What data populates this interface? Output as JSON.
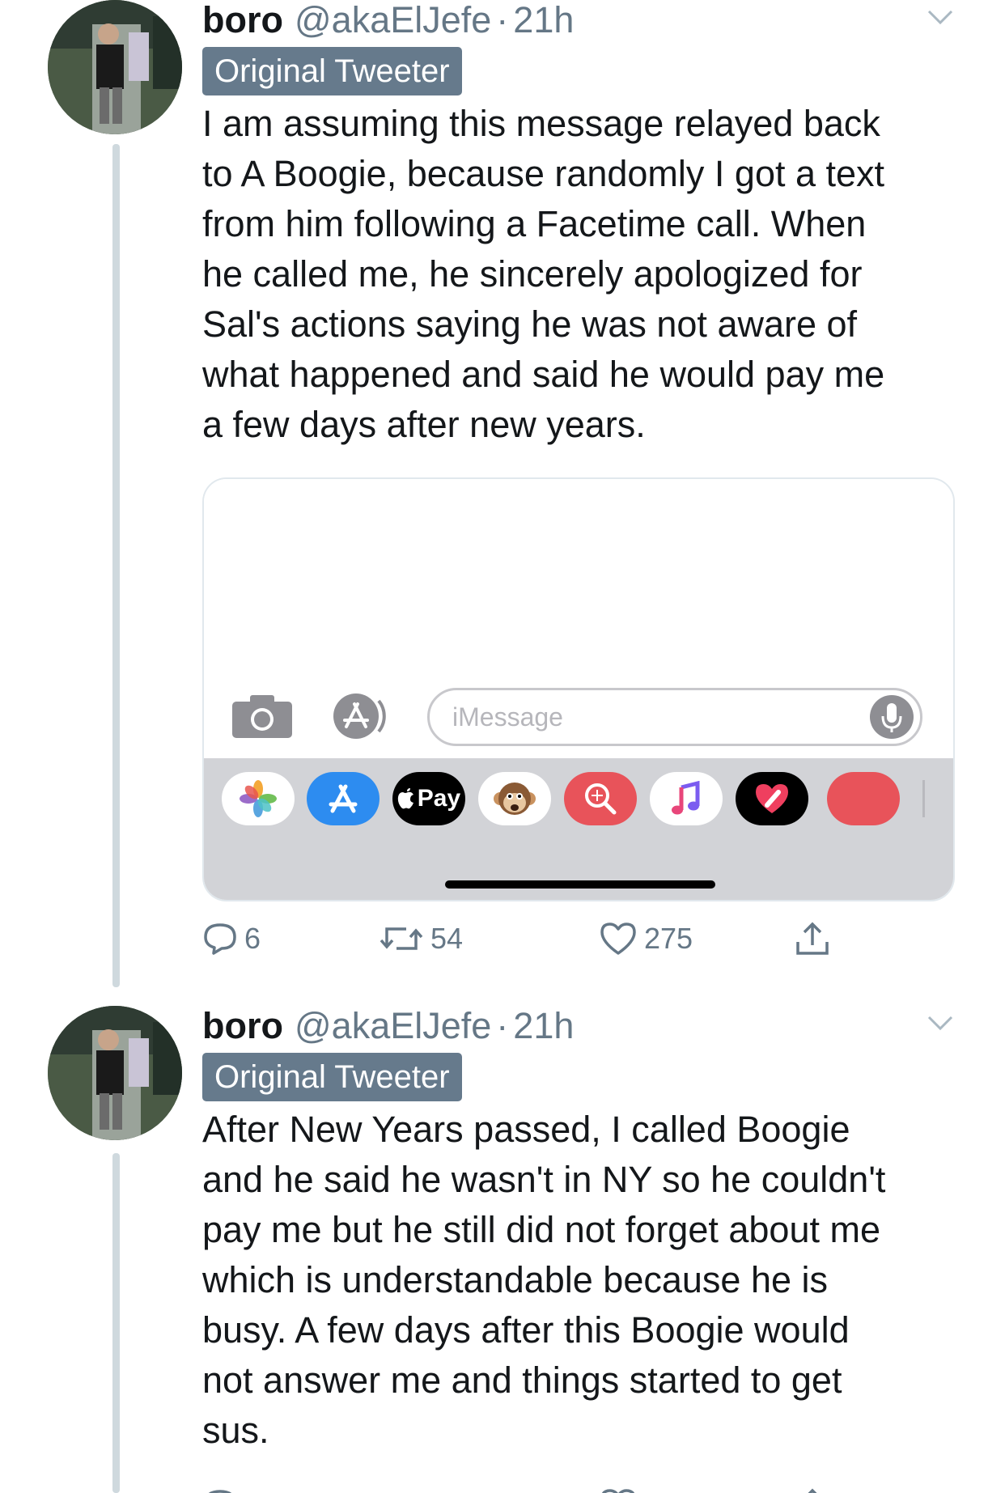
{
  "tweets": [
    {
      "name": "boro",
      "handle": "@akaElJefe",
      "separator": "·",
      "time": "21h",
      "badge": "Original Tweeter",
      "text_lines": [
        "I am assuming this message relayed back",
        "to A Boogie, because randomly I got a text",
        "from him following a Facetime call. When",
        "he called me, he sincerely apologized for",
        "Sal's actions saying he was not aware of",
        "what happened and said he would pay me",
        "a few days after new years."
      ],
      "media": {
        "imessage_placeholder": "iMessage",
        "apple_pay_label": "Pay",
        "apps": [
          "photos-icon",
          "app-store-icon",
          "apple-pay-icon",
          "animoji-monkey-icon",
          "images-search-icon",
          "music-icon",
          "digital-touch-icon",
          "partial-app-icon"
        ]
      },
      "actions": {
        "replies": "6",
        "retweets": "54",
        "likes": "275"
      }
    },
    {
      "name": "boro",
      "handle": "@akaElJefe",
      "separator": "·",
      "time": "21h",
      "badge": "Original Tweeter",
      "text_lines": [
        "After New Years passed, I called Boogie",
        "and he said he wasn't in NY so he couldn't",
        "pay me but he still did not forget about me",
        "which is understandable because he is",
        "busy.  A few days after this Boogie would",
        "not answer me and things started to get",
        "sus."
      ]
    }
  ],
  "colors": {
    "text": "#14171a",
    "secondary": "#657786",
    "badge_bg": "#667a8c",
    "thread_line": "#cfd9de",
    "tray_bg": "#d2d3d7"
  }
}
